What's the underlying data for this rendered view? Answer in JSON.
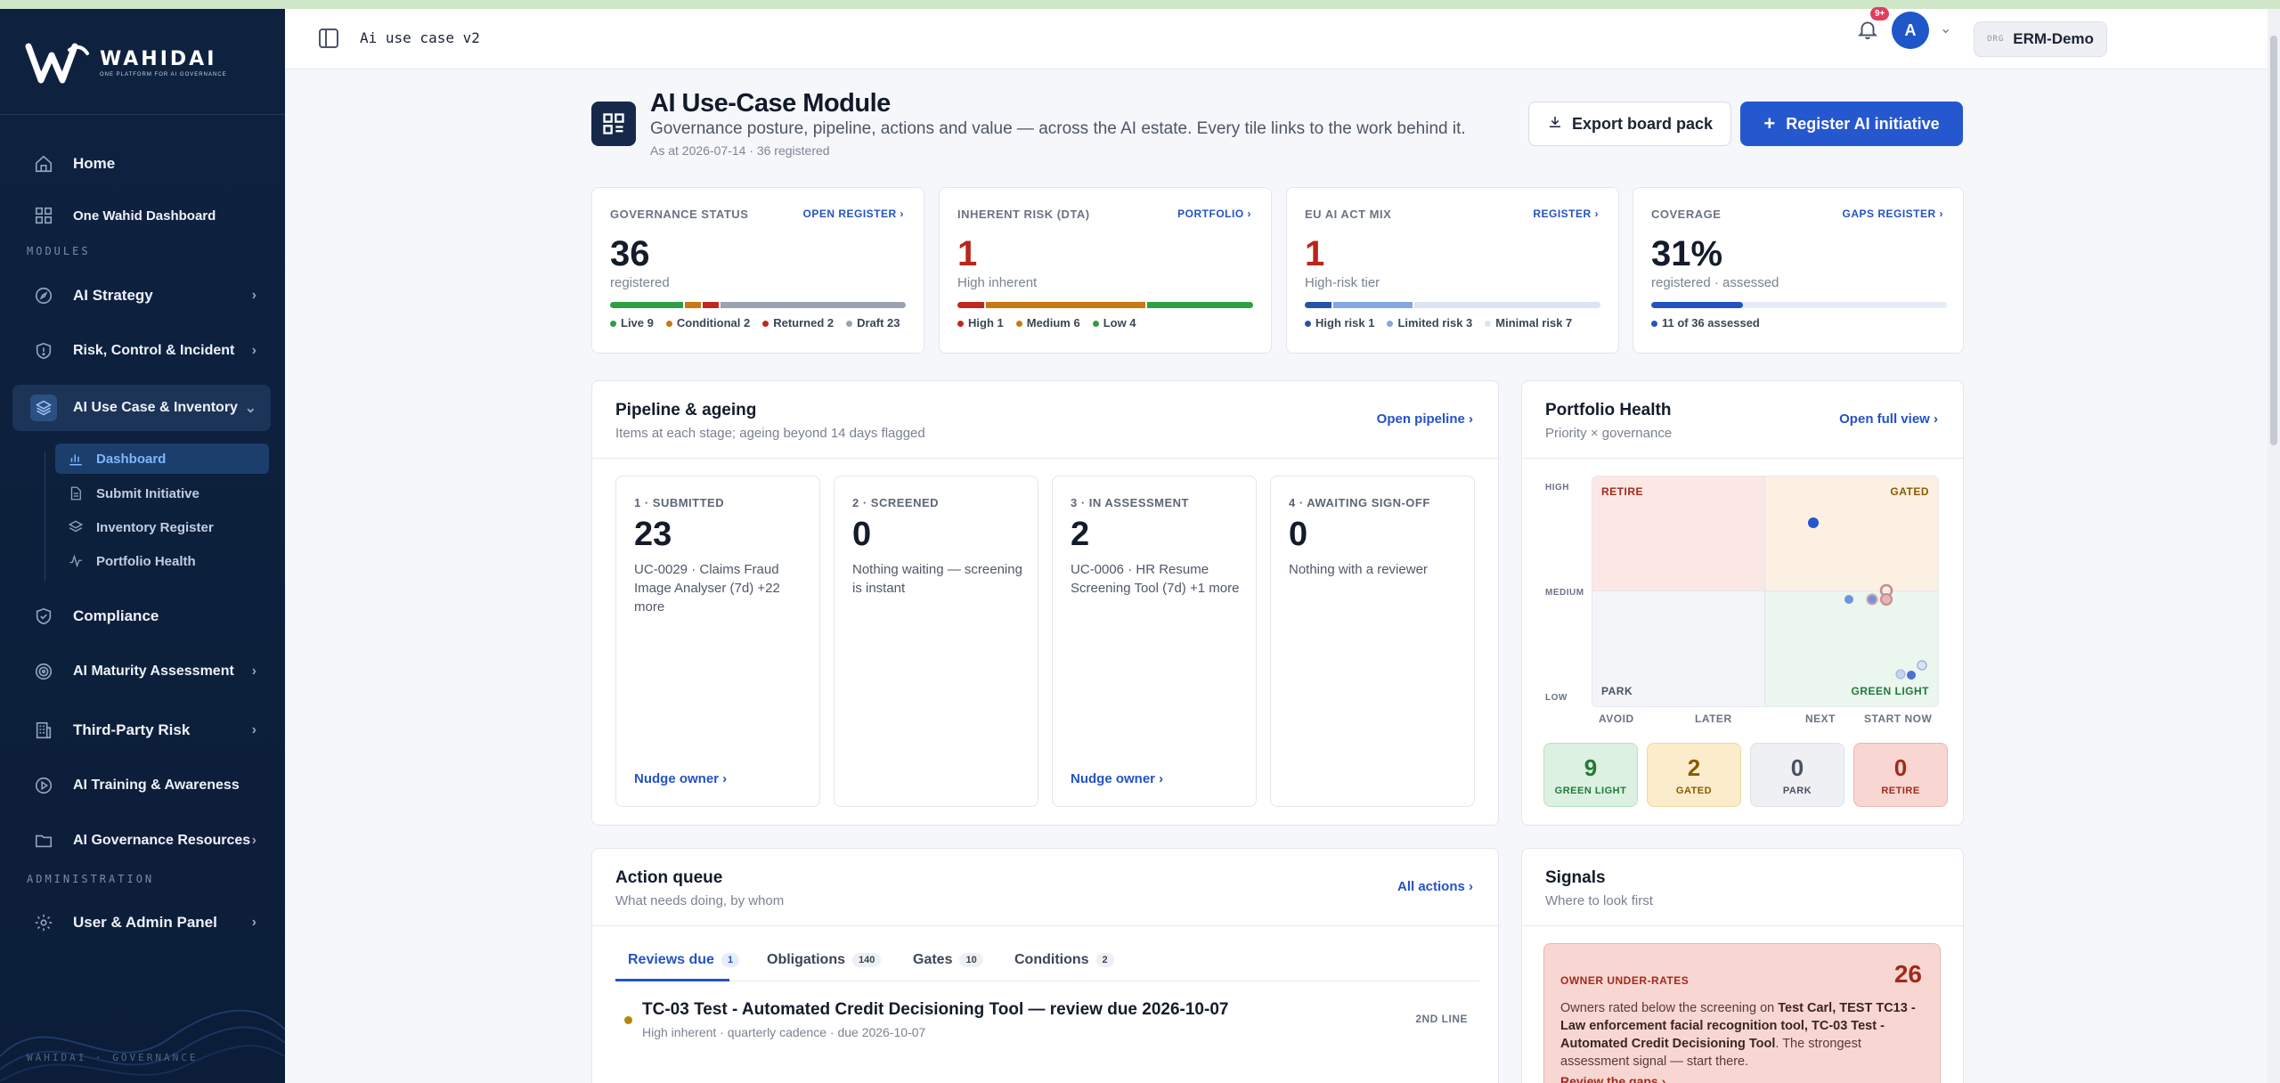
{
  "app": {
    "brand_name": "WAHIDAI",
    "brand_tagline": "ONE PLATFORM FOR AI GOVERNANCE",
    "footer": "WAHIDAI · GOVERNANCE"
  },
  "sidebar": {
    "items": [
      {
        "label": "Home",
        "icon": "home-icon"
      },
      {
        "label": "One Wahid Dashboard",
        "icon": "dashboard-icon"
      },
      {
        "label": "AI Strategy",
        "icon": "compass-icon"
      },
      {
        "label": "Risk, Control & Incident",
        "icon": "shield-alert-icon"
      },
      {
        "label": "AI Use Case & Inventory",
        "icon": "layers-icon"
      },
      {
        "label": "Compliance",
        "icon": "shield-check-icon"
      },
      {
        "label": "AI Maturity Assessment",
        "icon": "target-icon"
      },
      {
        "label": "Third-Party Risk",
        "icon": "building-icon"
      },
      {
        "label": "AI Training & Awareness",
        "icon": "play-circle-icon"
      },
      {
        "label": "AI Governance Resources",
        "icon": "folder-icon"
      },
      {
        "label": "User & Admin Panel",
        "icon": "gear-icon"
      }
    ],
    "section_modules": "MODULES",
    "section_admin": "ADMINISTRATION",
    "sub_items": [
      {
        "label": "Dashboard",
        "icon": "bar-chart-icon"
      },
      {
        "label": "Submit Initiative",
        "icon": "document-icon"
      },
      {
        "label": "Inventory Register",
        "icon": "stack-icon"
      },
      {
        "label": "Portfolio Health",
        "icon": "activity-icon"
      }
    ]
  },
  "topbar": {
    "title": "Ai use case v2",
    "org_key": "ORG",
    "org_name": "ERM-Demo",
    "notif_badge": "9+",
    "avatar_initial": "A"
  },
  "header": {
    "title": "AI Use-Case Module",
    "subtitle": "Governance posture, pipeline, actions and value — across the AI estate. Every tile links to the work behind it.",
    "as_at": "As at 2026-07-14 · 36 registered",
    "export_label": "Export board pack",
    "register_label": "Register AI initiative"
  },
  "kpis": [
    {
      "label": "GOVERNANCE STATUS",
      "link": "OPEN REGISTER ›",
      "value": "36",
      "caption": "registered",
      "segments": [
        {
          "label": "Live 9",
          "value": 9,
          "color": "#2f9e44"
        },
        {
          "label": "Conditional 2",
          "value": 2,
          "color": "#c77a12"
        },
        {
          "label": "Returned 2",
          "value": 2,
          "color": "#c0281f"
        },
        {
          "label": "Draft 23",
          "value": 23,
          "color": "#9aa3b1"
        }
      ]
    },
    {
      "label": "INHERENT RISK (DTA)",
      "link": "PORTFOLIO ›",
      "value": "1",
      "caption": "High inherent",
      "segments": [
        {
          "label": "High 1",
          "value": 1,
          "color": "#c0281f"
        },
        {
          "label": "Medium 6",
          "value": 6,
          "color": "#c77a12"
        },
        {
          "label": "Low 4",
          "value": 4,
          "color": "#2f9e44"
        }
      ]
    },
    {
      "label": "EU AI ACT MIX",
      "link": "REGISTER ›",
      "value": "1",
      "caption": "High-risk tier",
      "segments": [
        {
          "label": "High risk 1",
          "value": 1,
          "color": "#2453a8"
        },
        {
          "label": "Limited risk 3",
          "value": 3,
          "color": "#86a6df"
        },
        {
          "label": "Minimal risk 7",
          "value": 7,
          "color": "#dbe4f3"
        }
      ]
    },
    {
      "label": "COVERAGE",
      "link": "GAPS REGISTER ›",
      "value": "31%",
      "caption": "registered · assessed",
      "progress": 0.31,
      "segments": [
        {
          "label": "11 of 36 assessed",
          "value": 11,
          "color": "#2453c2"
        }
      ]
    }
  ],
  "pipeline": {
    "title": "Pipeline & ageing",
    "subtitle": "Items at each stage; ageing beyond 14 days flagged",
    "link": "Open pipeline ›",
    "stages": [
      {
        "label": "1 · SUBMITTED",
        "value": "23",
        "note": "UC-0029 · Claims Fraud Image Analyser (7d) +22 more",
        "nudge": "Nudge owner ›"
      },
      {
        "label": "2 · SCREENED",
        "value": "0",
        "note": "Nothing waiting — screening is instant",
        "nudge": ""
      },
      {
        "label": "3 · IN ASSESSMENT",
        "value": "2",
        "note": "UC-0006 · HR Resume Screening Tool (7d) +1 more",
        "nudge": "Nudge owner ›"
      },
      {
        "label": "4 · AWAITING SIGN-OFF",
        "value": "0",
        "note": "Nothing with a reviewer",
        "nudge": ""
      }
    ]
  },
  "portfolio": {
    "title": "Portfolio Health",
    "subtitle": "Priority × governance",
    "link": "Open full view ›",
    "y_ticks": [
      "HIGH",
      "MEDIUM",
      "LOW"
    ],
    "x_ticks": [
      "AVOID",
      "LATER",
      "NEXT",
      "START NOW"
    ],
    "quadrants": {
      "retire": "RETIRE",
      "gated": "GATED",
      "park": "PARK",
      "green": "GREEN LIGHT"
    },
    "tiles": [
      {
        "value": "9",
        "label": "GREEN LIGHT",
        "bg": "#dcf1e1",
        "fg": "#207a3a"
      },
      {
        "value": "2",
        "label": "GATED",
        "bg": "#fbeccb",
        "fg": "#8a5a00"
      },
      {
        "value": "0",
        "label": "PARK",
        "bg": "#eef0f4",
        "fg": "#4a5262"
      },
      {
        "value": "0",
        "label": "RETIRE",
        "bg": "#f8d7d3",
        "fg": "#a12a1c"
      }
    ]
  },
  "actions": {
    "title": "Action queue",
    "subtitle": "What needs doing, by whom",
    "link": "All actions ›",
    "tabs": [
      {
        "label": "Reviews due",
        "count": "1"
      },
      {
        "label": "Obligations",
        "count": "140"
      },
      {
        "label": "Gates",
        "count": "10"
      },
      {
        "label": "Conditions",
        "count": "2"
      }
    ],
    "items": [
      {
        "title": "TC-03 Test - Automated Credit Decisioning Tool — review due 2026-10-07",
        "meta": "High inherent · quarterly cadence · due 2026-10-07",
        "tag": "2ND LINE"
      }
    ]
  },
  "signals": {
    "title": "Signals",
    "subtitle": "Where to look first",
    "card": {
      "label": "OWNER UNDER-RATES",
      "value": "26",
      "text_pre": "Owners rated below the screening on ",
      "text_bold": "Test Carl, TEST TC13 - Law enforcement facial recognition tool, TC-03 Test - Automated Credit Decisioning Tool",
      "text_post": ". The strongest assessment signal — start there.",
      "link": "Review the gaps ›"
    }
  },
  "colors": {
    "accent": "#2557cf",
    "sidebar": "#0e2240",
    "danger": "#b7261b"
  }
}
